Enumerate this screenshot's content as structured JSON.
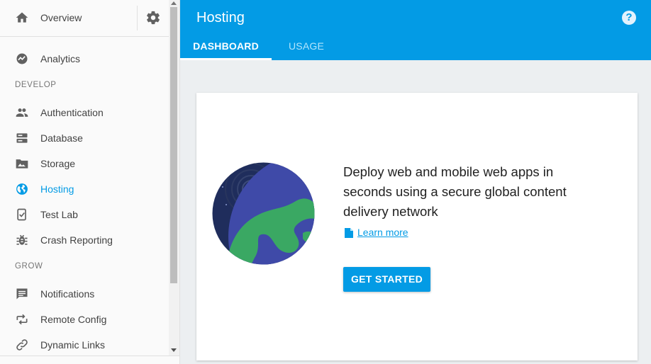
{
  "sidebar": {
    "overview": {
      "label": "Overview",
      "icon": "home-icon",
      "settings_icon": "gear-icon"
    },
    "items_top": [
      {
        "label": "Analytics",
        "icon": "analytics-icon"
      }
    ],
    "sections": [
      {
        "title": "DEVELOP",
        "items": [
          {
            "label": "Authentication",
            "icon": "people-icon"
          },
          {
            "label": "Database",
            "icon": "database-icon"
          },
          {
            "label": "Storage",
            "icon": "folder-image-icon"
          },
          {
            "label": "Hosting",
            "icon": "globe-icon",
            "active": true
          },
          {
            "label": "Test Lab",
            "icon": "test-lab-icon"
          },
          {
            "label": "Crash Reporting",
            "icon": "bug-icon"
          }
        ]
      },
      {
        "title": "GROW",
        "items": [
          {
            "label": "Notifications",
            "icon": "message-icon"
          },
          {
            "label": "Remote Config",
            "icon": "remote-config-icon"
          },
          {
            "label": "Dynamic Links",
            "icon": "link-icon"
          }
        ]
      }
    ]
  },
  "header": {
    "title": "Hosting",
    "help_icon": "help-icon",
    "help_symbol": "?",
    "tabs": [
      {
        "label": "DASHBOARD",
        "active": true
      },
      {
        "label": "USAGE",
        "active": false
      }
    ]
  },
  "card": {
    "headline": "Deploy web and mobile web apps in seconds using a secure global content delivery network",
    "learn_more": "Learn more",
    "cta": "GET STARTED"
  },
  "colors": {
    "accent": "#039be5",
    "background": "#eceff1",
    "sidebar": "#fafafa"
  }
}
